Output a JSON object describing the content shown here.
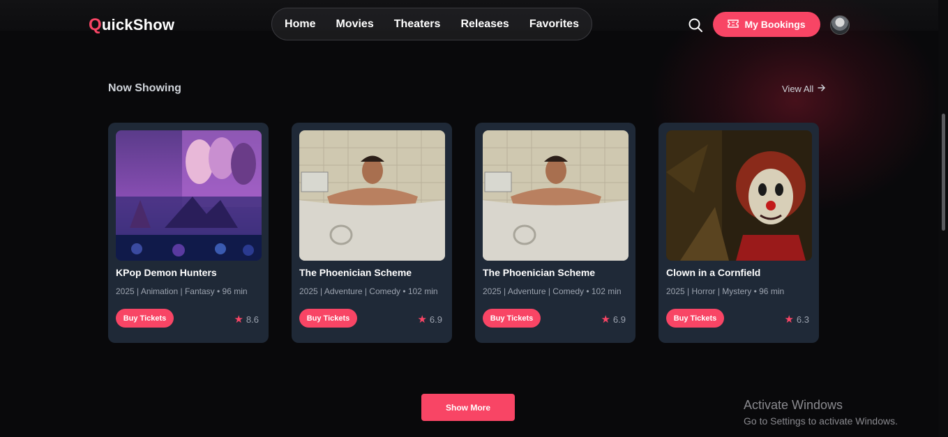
{
  "app": {
    "logo_initial": "Q",
    "logo_rest": "uickShow",
    "accent_color": "#f84565"
  },
  "nav": {
    "items": [
      "Home",
      "Movies",
      "Theaters",
      "Releases",
      "Favorites"
    ]
  },
  "header": {
    "bookings_label": "My Bookings",
    "search_icon": "search-icon",
    "ticket_icon": "ticket-icon"
  },
  "section": {
    "title": "Now Showing",
    "view_all": "View All"
  },
  "movies": [
    {
      "title": "KPop Demon Hunters",
      "meta": "2025 | Animation | Fantasy • 96 min",
      "rating": "8.6",
      "buy_label": "Buy Tickets"
    },
    {
      "title": "The Phoenician Scheme",
      "meta": "2025 | Adventure | Comedy • 102 min",
      "rating": "6.9",
      "buy_label": "Buy Tickets"
    },
    {
      "title": "The Phoenician Scheme",
      "meta": "2025 | Adventure | Comedy • 102 min",
      "rating": "6.9",
      "buy_label": "Buy Tickets"
    },
    {
      "title": "Clown in a Cornfield",
      "meta": "2025 | Horror | Mystery • 96 min",
      "rating": "6.3",
      "buy_label": "Buy Tickets"
    }
  ],
  "show_more": "Show More",
  "windows_watermark": {
    "line1": "Activate Windows",
    "line2": "Go to Settings to activate Windows."
  }
}
